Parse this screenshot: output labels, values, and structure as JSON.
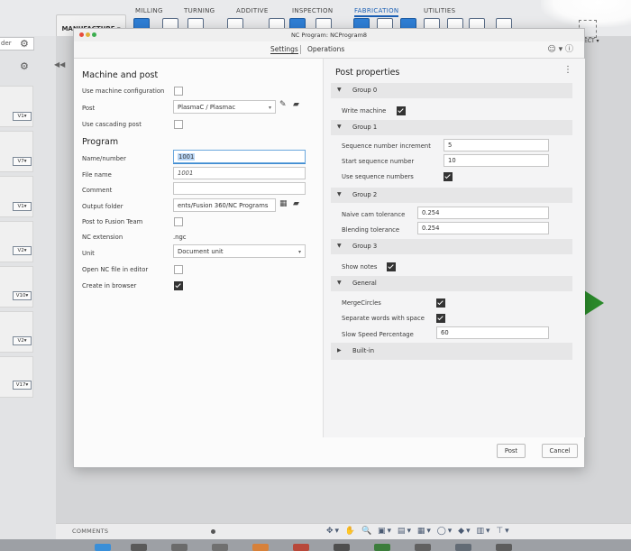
{
  "ribbon": {
    "tabs": [
      "MILLING",
      "TURNING",
      "ADDITIVE",
      "INSPECTION",
      "FABRICATION",
      "UTILITIES"
    ],
    "active_tab": "FABRICATION",
    "workspace": "MANUFACTURE ▾"
  },
  "browser": {
    "search": "der",
    "node_tags": [
      "V1▾",
      "V7▾",
      "V1▾",
      "V2▾",
      "V10▾",
      "V2▾",
      "V17▾"
    ]
  },
  "canvas": {
    "corner_label": "ECT ▾"
  },
  "bottom": {
    "comments": "COMMENTS",
    "nav_tools": "✥▾ ✋ 🔍 ▣▾ ▤▾ ▦▾ ◯▾ ◆▾ ▥▾ ⊤▾"
  },
  "dialog": {
    "title": "NC Program: NCProgram8",
    "tabs": [
      "Settings",
      "Operations"
    ],
    "active_tab": "Settings",
    "help": "☺ ▾ ⓘ",
    "left": {
      "machine_section": "Machine and post",
      "use_machine_config_label": "Use machine configuration",
      "use_machine_config": false,
      "post_label": "Post",
      "post_value": "PlasmaC / Plasmac",
      "cascading_label": "Use cascading post",
      "cascading": false,
      "program_section": "Program",
      "name_label": "Name/number",
      "name_value": "1001",
      "file_label": "File name",
      "file_value": "1001",
      "comment_label": "Comment",
      "comment_value": "",
      "output_label": "Output folder",
      "output_value": "ents/Fusion 360/NC Programs",
      "post_team_label": "Post to Fusion Team",
      "post_team": false,
      "nc_ext_label": "NC extension",
      "nc_ext_value": ".ngc",
      "unit_label": "Unit",
      "unit_value": "Document unit",
      "open_editor_label": "Open NC file in editor",
      "open_editor": false,
      "create_browser_label": "Create in browser",
      "create_browser": true
    },
    "right": {
      "section": "Post properties",
      "kebab": "⋮",
      "group0": "Group 0",
      "write_machine_label": "Write machine",
      "write_machine": true,
      "group1": "Group 1",
      "seq_inc_label": "Sequence number increment",
      "seq_inc_value": "5",
      "start_seq_label": "Start sequence number",
      "start_seq_value": "10",
      "use_seq_label": "Use sequence numbers",
      "use_seq": true,
      "group2": "Group 2",
      "naive_label": "Naive cam tolerance",
      "naive_value": "0.254",
      "blend_label": "Blending tolerance",
      "blend_value": "0.254",
      "group3": "Group 3",
      "show_notes_label": "Show notes",
      "show_notes": true,
      "general": "General",
      "merge_label": "MergeCircles",
      "merge": true,
      "separate_label": "Separate words with space",
      "separate": true,
      "slow_label": "Slow Speed Percentage",
      "slow_value": "60",
      "builtin": "Built-in"
    },
    "buttons": {
      "post": "Post",
      "cancel": "Cancel"
    }
  },
  "colors": {
    "accent": "#1a5fb4",
    "focus": "#3d8ad1",
    "group_bg": "#e6e6e7",
    "green_marker": "#2b8a2b"
  }
}
